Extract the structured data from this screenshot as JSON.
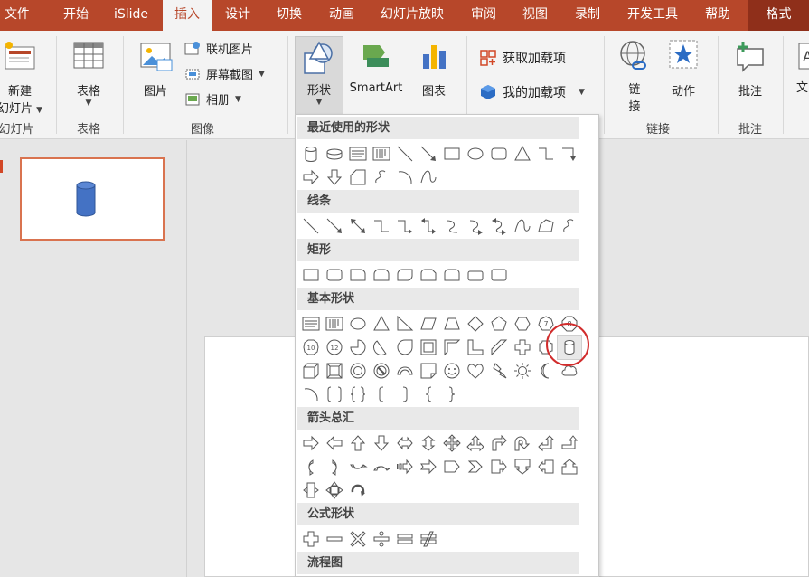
{
  "tabs": [
    {
      "label": "文件"
    },
    {
      "label": "开始"
    },
    {
      "label": "iSlide"
    },
    {
      "label": "插入"
    },
    {
      "label": "设计"
    },
    {
      "label": "切换"
    },
    {
      "label": "动画"
    },
    {
      "label": "幻灯片放映"
    },
    {
      "label": "审阅"
    },
    {
      "label": "视图"
    },
    {
      "label": "录制"
    },
    {
      "label": "开发工具"
    },
    {
      "label": "帮助"
    },
    {
      "label": "格式"
    }
  ],
  "ribbon": {
    "new_slide": {
      "line1": "新建",
      "line2": "幻灯片"
    },
    "table": "表格",
    "picture": "图片",
    "online_picture": "联机图片",
    "screenshot": "屏幕截图",
    "album": "相册",
    "shapes": "形状",
    "smartart": "SmartArt",
    "chart": "图表",
    "get_addins": "获取加载项",
    "my_addins": "我的加载项",
    "link": {
      "line1": "链",
      "line2": "接"
    },
    "action": "动作",
    "comment": "批注",
    "text": "文",
    "groups": {
      "slides": "幻灯片",
      "tables": "表格",
      "images": "图像",
      "links": "链接",
      "comments": "批注"
    }
  },
  "dropdown": {
    "sections": [
      {
        "title": "最近使用的形状"
      },
      {
        "title": "线条"
      },
      {
        "title": "矩形"
      },
      {
        "title": "基本形状"
      },
      {
        "title": "箭头总汇"
      },
      {
        "title": "公式形状"
      },
      {
        "title": "流程图"
      }
    ]
  },
  "colors": {
    "accent": "#b7472a",
    "format_tab": "#8f2f1a",
    "highlight_circle": "#d12c2c",
    "cylinder": "#4472c4"
  }
}
